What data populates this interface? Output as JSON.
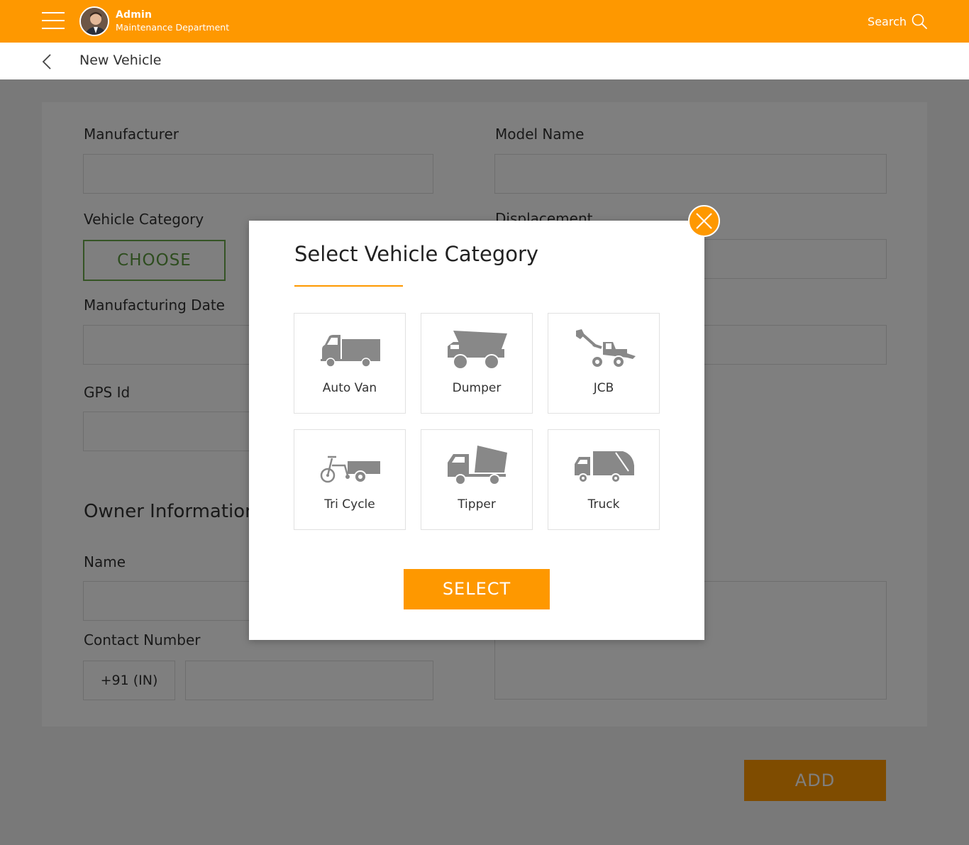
{
  "topbar": {
    "user_name": "Admin",
    "department": "Maintenance Department",
    "search_label": "Search"
  },
  "subbar": {
    "title": "New Vehicle"
  },
  "form": {
    "manufacturer_label": "Manufacturer",
    "model_name_label": "Model Name",
    "vehicle_category_label": "Vehicle Category",
    "choose_label": "CHOOSE",
    "displacement_label": "Displacement",
    "manufacturing_date_label": "Manufacturing Date",
    "gps_id_label": "GPS Id",
    "owner_section_title": "Owner Information",
    "name_label": "Name",
    "contact_number_label": "Contact Number",
    "country_code": "+91 (IN)",
    "add_label": "ADD"
  },
  "modal": {
    "title": "Select Vehicle Category",
    "select_label": "SELECT",
    "categories": [
      {
        "label": "Auto Van",
        "icon": "auto-van-icon"
      },
      {
        "label": "Dumper",
        "icon": "dumper-icon"
      },
      {
        "label": "JCB",
        "icon": "jcb-icon"
      },
      {
        "label": "Tri Cycle",
        "icon": "tri-cycle-icon"
      },
      {
        "label": "Tipper",
        "icon": "tipper-icon"
      },
      {
        "label": "Truck",
        "icon": "truck-icon"
      }
    ]
  },
  "colors": {
    "brand": "#fe9800",
    "choose_green": "#5d9a3f",
    "icon_gray": "#888888"
  }
}
